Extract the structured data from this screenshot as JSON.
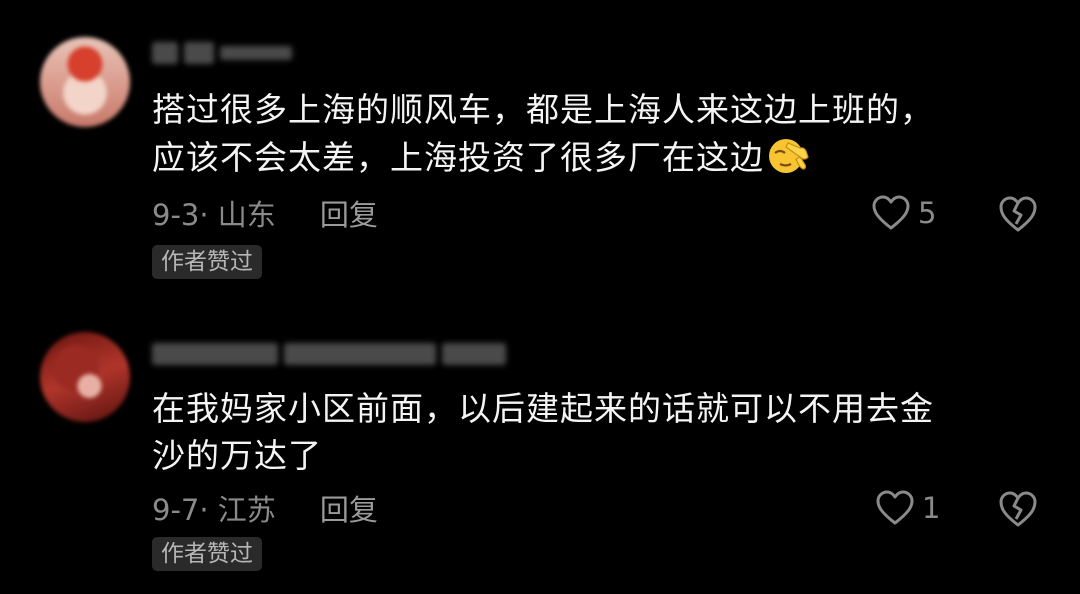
{
  "comments": [
    {
      "text_line1": "搭过很多上海的顺风车，都是上海人来这边上班的，",
      "text_line2": "应该不会太差，上海投资了很多厂在这边",
      "date_location": "9-3· 山东",
      "reply_label": "回复",
      "likes": "5",
      "badge": "作者赞过"
    },
    {
      "text_line1": "在我妈家小区前面，以后建起来的话就可以不用去金",
      "text_line2": "沙的万达了",
      "date_location": "9-7· 江苏",
      "reply_label": "回复",
      "likes": "1",
      "badge": "作者赞过"
    }
  ],
  "icons": {
    "like": "heart-outline-icon",
    "dislike": "broken-heart-icon",
    "emoji": "facepalm-emoji"
  },
  "colors": {
    "background": "#000000",
    "text": "#f4f4f4",
    "meta": "#8a8a8a",
    "badge_bg": "#2a2a2a"
  }
}
